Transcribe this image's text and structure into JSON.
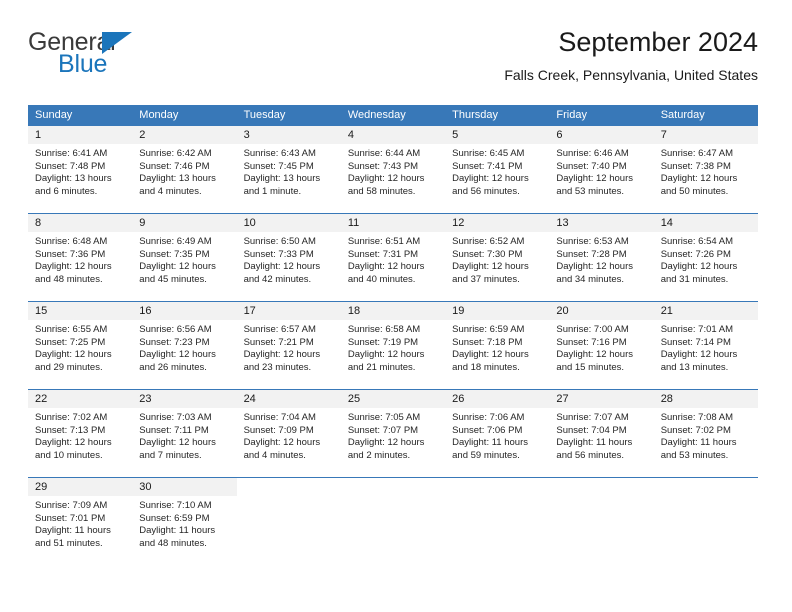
{
  "brand": {
    "name_top": "General",
    "name_bottom": "Blue"
  },
  "header": {
    "title": "September 2024",
    "subtitle": "Falls Creek, Pennsylvania, United States"
  },
  "colors": {
    "header_blue": "#3878b8",
    "brand_blue": "#1b75bb",
    "daynum_band": "#f2f2f2"
  },
  "weekdays": [
    "Sunday",
    "Monday",
    "Tuesday",
    "Wednesday",
    "Thursday",
    "Friday",
    "Saturday"
  ],
  "weeks": [
    [
      {
        "day": "1",
        "sunrise": "Sunrise: 6:41 AM",
        "sunset": "Sunset: 7:48 PM",
        "daylight_line1": "Daylight: 13 hours",
        "daylight_line2": "and 6 minutes."
      },
      {
        "day": "2",
        "sunrise": "Sunrise: 6:42 AM",
        "sunset": "Sunset: 7:46 PM",
        "daylight_line1": "Daylight: 13 hours",
        "daylight_line2": "and 4 minutes."
      },
      {
        "day": "3",
        "sunrise": "Sunrise: 6:43 AM",
        "sunset": "Sunset: 7:45 PM",
        "daylight_line1": "Daylight: 13 hours",
        "daylight_line2": "and 1 minute."
      },
      {
        "day": "4",
        "sunrise": "Sunrise: 6:44 AM",
        "sunset": "Sunset: 7:43 PM",
        "daylight_line1": "Daylight: 12 hours",
        "daylight_line2": "and 58 minutes."
      },
      {
        "day": "5",
        "sunrise": "Sunrise: 6:45 AM",
        "sunset": "Sunset: 7:41 PM",
        "daylight_line1": "Daylight: 12 hours",
        "daylight_line2": "and 56 minutes."
      },
      {
        "day": "6",
        "sunrise": "Sunrise: 6:46 AM",
        "sunset": "Sunset: 7:40 PM",
        "daylight_line1": "Daylight: 12 hours",
        "daylight_line2": "and 53 minutes."
      },
      {
        "day": "7",
        "sunrise": "Sunrise: 6:47 AM",
        "sunset": "Sunset: 7:38 PM",
        "daylight_line1": "Daylight: 12 hours",
        "daylight_line2": "and 50 minutes."
      }
    ],
    [
      {
        "day": "8",
        "sunrise": "Sunrise: 6:48 AM",
        "sunset": "Sunset: 7:36 PM",
        "daylight_line1": "Daylight: 12 hours",
        "daylight_line2": "and 48 minutes."
      },
      {
        "day": "9",
        "sunrise": "Sunrise: 6:49 AM",
        "sunset": "Sunset: 7:35 PM",
        "daylight_line1": "Daylight: 12 hours",
        "daylight_line2": "and 45 minutes."
      },
      {
        "day": "10",
        "sunrise": "Sunrise: 6:50 AM",
        "sunset": "Sunset: 7:33 PM",
        "daylight_line1": "Daylight: 12 hours",
        "daylight_line2": "and 42 minutes."
      },
      {
        "day": "11",
        "sunrise": "Sunrise: 6:51 AM",
        "sunset": "Sunset: 7:31 PM",
        "daylight_line1": "Daylight: 12 hours",
        "daylight_line2": "and 40 minutes."
      },
      {
        "day": "12",
        "sunrise": "Sunrise: 6:52 AM",
        "sunset": "Sunset: 7:30 PM",
        "daylight_line1": "Daylight: 12 hours",
        "daylight_line2": "and 37 minutes."
      },
      {
        "day": "13",
        "sunrise": "Sunrise: 6:53 AM",
        "sunset": "Sunset: 7:28 PM",
        "daylight_line1": "Daylight: 12 hours",
        "daylight_line2": "and 34 minutes."
      },
      {
        "day": "14",
        "sunrise": "Sunrise: 6:54 AM",
        "sunset": "Sunset: 7:26 PM",
        "daylight_line1": "Daylight: 12 hours",
        "daylight_line2": "and 31 minutes."
      }
    ],
    [
      {
        "day": "15",
        "sunrise": "Sunrise: 6:55 AM",
        "sunset": "Sunset: 7:25 PM",
        "daylight_line1": "Daylight: 12 hours",
        "daylight_line2": "and 29 minutes."
      },
      {
        "day": "16",
        "sunrise": "Sunrise: 6:56 AM",
        "sunset": "Sunset: 7:23 PM",
        "daylight_line1": "Daylight: 12 hours",
        "daylight_line2": "and 26 minutes."
      },
      {
        "day": "17",
        "sunrise": "Sunrise: 6:57 AM",
        "sunset": "Sunset: 7:21 PM",
        "daylight_line1": "Daylight: 12 hours",
        "daylight_line2": "and 23 minutes."
      },
      {
        "day": "18",
        "sunrise": "Sunrise: 6:58 AM",
        "sunset": "Sunset: 7:19 PM",
        "daylight_line1": "Daylight: 12 hours",
        "daylight_line2": "and 21 minutes."
      },
      {
        "day": "19",
        "sunrise": "Sunrise: 6:59 AM",
        "sunset": "Sunset: 7:18 PM",
        "daylight_line1": "Daylight: 12 hours",
        "daylight_line2": "and 18 minutes."
      },
      {
        "day": "20",
        "sunrise": "Sunrise: 7:00 AM",
        "sunset": "Sunset: 7:16 PM",
        "daylight_line1": "Daylight: 12 hours",
        "daylight_line2": "and 15 minutes."
      },
      {
        "day": "21",
        "sunrise": "Sunrise: 7:01 AM",
        "sunset": "Sunset: 7:14 PM",
        "daylight_line1": "Daylight: 12 hours",
        "daylight_line2": "and 13 minutes."
      }
    ],
    [
      {
        "day": "22",
        "sunrise": "Sunrise: 7:02 AM",
        "sunset": "Sunset: 7:13 PM",
        "daylight_line1": "Daylight: 12 hours",
        "daylight_line2": "and 10 minutes."
      },
      {
        "day": "23",
        "sunrise": "Sunrise: 7:03 AM",
        "sunset": "Sunset: 7:11 PM",
        "daylight_line1": "Daylight: 12 hours",
        "daylight_line2": "and 7 minutes."
      },
      {
        "day": "24",
        "sunrise": "Sunrise: 7:04 AM",
        "sunset": "Sunset: 7:09 PM",
        "daylight_line1": "Daylight: 12 hours",
        "daylight_line2": "and 4 minutes."
      },
      {
        "day": "25",
        "sunrise": "Sunrise: 7:05 AM",
        "sunset": "Sunset: 7:07 PM",
        "daylight_line1": "Daylight: 12 hours",
        "daylight_line2": "and 2 minutes."
      },
      {
        "day": "26",
        "sunrise": "Sunrise: 7:06 AM",
        "sunset": "Sunset: 7:06 PM",
        "daylight_line1": "Daylight: 11 hours",
        "daylight_line2": "and 59 minutes."
      },
      {
        "day": "27",
        "sunrise": "Sunrise: 7:07 AM",
        "sunset": "Sunset: 7:04 PM",
        "daylight_line1": "Daylight: 11 hours",
        "daylight_line2": "and 56 minutes."
      },
      {
        "day": "28",
        "sunrise": "Sunrise: 7:08 AM",
        "sunset": "Sunset: 7:02 PM",
        "daylight_line1": "Daylight: 11 hours",
        "daylight_line2": "and 53 minutes."
      }
    ],
    [
      {
        "day": "29",
        "sunrise": "Sunrise: 7:09 AM",
        "sunset": "Sunset: 7:01 PM",
        "daylight_line1": "Daylight: 11 hours",
        "daylight_line2": "and 51 minutes."
      },
      {
        "day": "30",
        "sunrise": "Sunrise: 7:10 AM",
        "sunset": "Sunset: 6:59 PM",
        "daylight_line1": "Daylight: 11 hours",
        "daylight_line2": "and 48 minutes."
      },
      {
        "day": "",
        "sunrise": "",
        "sunset": "",
        "daylight_line1": "",
        "daylight_line2": ""
      },
      {
        "day": "",
        "sunrise": "",
        "sunset": "",
        "daylight_line1": "",
        "daylight_line2": ""
      },
      {
        "day": "",
        "sunrise": "",
        "sunset": "",
        "daylight_line1": "",
        "daylight_line2": ""
      },
      {
        "day": "",
        "sunrise": "",
        "sunset": "",
        "daylight_line1": "",
        "daylight_line2": ""
      },
      {
        "day": "",
        "sunrise": "",
        "sunset": "",
        "daylight_line1": "",
        "daylight_line2": ""
      }
    ]
  ]
}
